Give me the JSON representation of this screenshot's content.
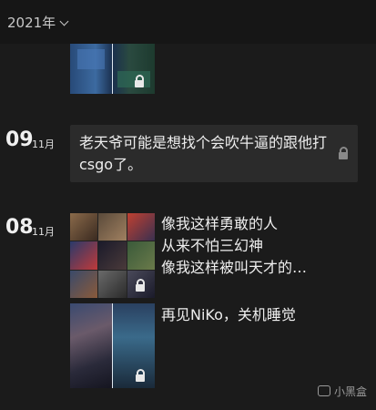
{
  "header": {
    "year_label": "2021年"
  },
  "posts": [
    {
      "day": "09",
      "month": "11月",
      "text": "老天爷可能是想找个会吹牛逼的跟他打csgo了。"
    },
    {
      "day": "08",
      "month": "11月",
      "text_lines": [
        "像我这样勇敢的人",
        "从来不怕三幻神",
        "像我这样被叫天才的…"
      ]
    },
    {
      "text": "再见NiKo，关机睡觉"
    }
  ],
  "watermark": {
    "text": "小黑盒"
  },
  "colors": {
    "background": "#1b1b1b",
    "card": "#2b2b2b",
    "header": "#161616"
  }
}
